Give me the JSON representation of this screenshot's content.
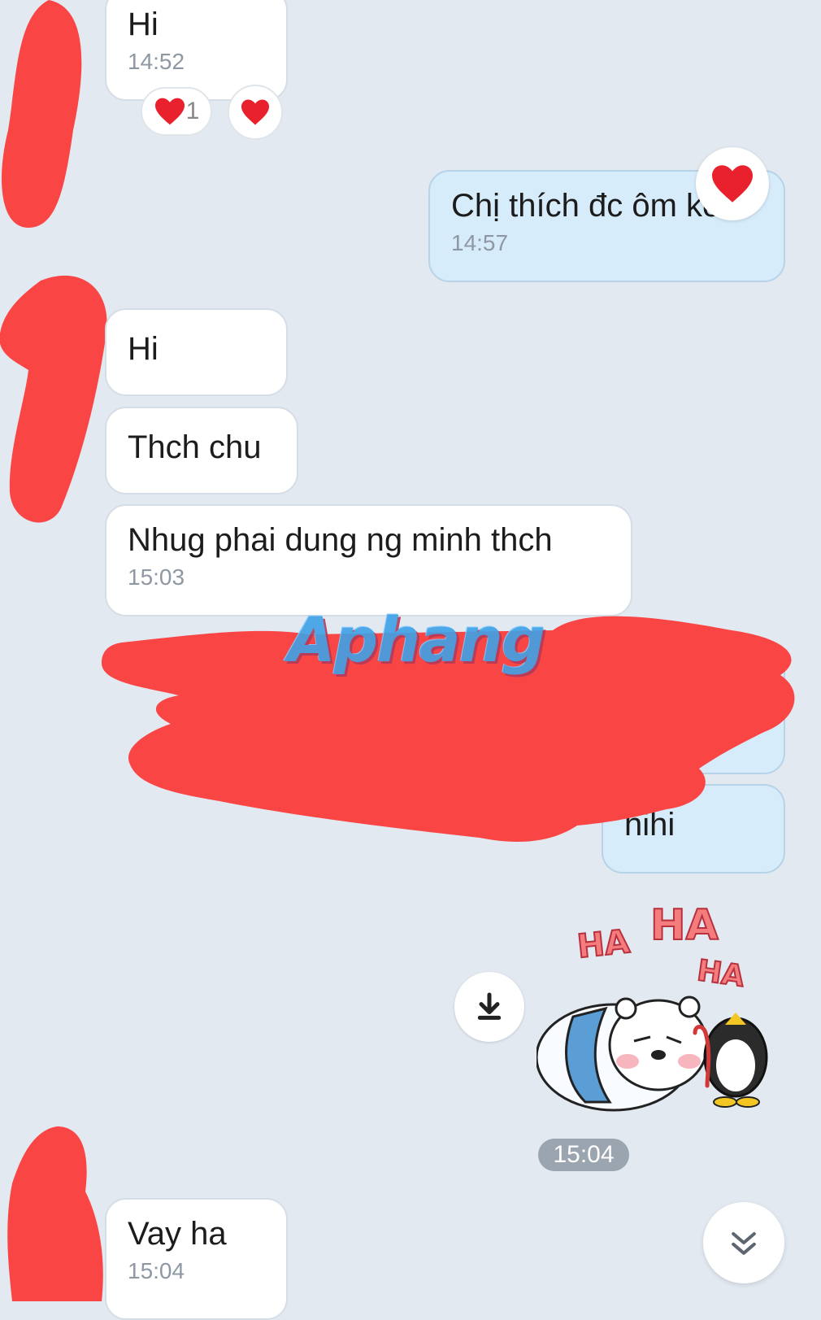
{
  "messages": [
    {
      "id": "m1",
      "side": "in",
      "text": "Hi",
      "time": "14:52"
    },
    {
      "id": "m2",
      "side": "out",
      "text": "Chị thích đc ôm ko",
      "time": "14:57"
    },
    {
      "id": "m3",
      "side": "in",
      "text": "Hi",
      "time": ""
    },
    {
      "id": "m4",
      "side": "in",
      "text": "Thch chu",
      "time": ""
    },
    {
      "id": "m5",
      "side": "in",
      "text": "Nhug phai dung ng minh thch",
      "time": "15:03"
    },
    {
      "id": "m6",
      "side": "out",
      "text": "hihi",
      "time": ""
    },
    {
      "id": "m7",
      "side": "in",
      "text": "Vay ha",
      "time": "15:04"
    }
  ],
  "reactions": {
    "m1_count": "1",
    "heart_color": "#e8212c"
  },
  "sticker": {
    "time": "15:04",
    "texts": [
      "HA",
      "HA",
      "HA"
    ]
  },
  "watermark": "Aphang",
  "icons": [
    "heart-icon",
    "download-icon",
    "chevron-double-down-icon"
  ],
  "colors": {
    "background": "#e2e9f1",
    "incoming": "#ffffff",
    "outgoing": "#d6ecfb",
    "redaction": "#fa4545"
  }
}
